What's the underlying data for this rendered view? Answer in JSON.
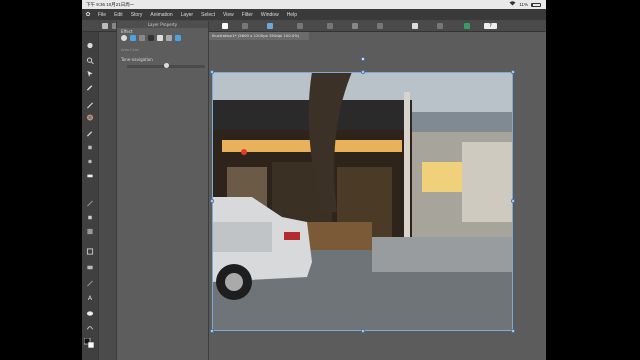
{
  "status": {
    "time": "下午 9:36",
    "date": "10月21日周一",
    "battery": "11%",
    "battery_level": 0.11
  },
  "menu": [
    "File",
    "Edit",
    "Story",
    "Animation",
    "Layer",
    "Select",
    "View",
    "Filter",
    "Window",
    "Help"
  ],
  "panel": {
    "title": "Layer Property",
    "effect_label": "Effect",
    "field_1": "Area Color",
    "tone_label": "Tone-navigation",
    "tone_value": 0.5
  },
  "document": {
    "tab_title": "Illustration1* (5600 x 1200px 350dpi 100.0%)"
  },
  "icons": {
    "logo": "app-logo-icon",
    "wifi": "wifi-icon",
    "battery": "battery-icon",
    "help": "help-icon",
    "color": "color-wheel-icon"
  },
  "colors": {
    "menubar": "#3a3a3a",
    "panel": "#5d5d5d",
    "selection": "#7fa9d8",
    "accent": "#4aa3df"
  }
}
